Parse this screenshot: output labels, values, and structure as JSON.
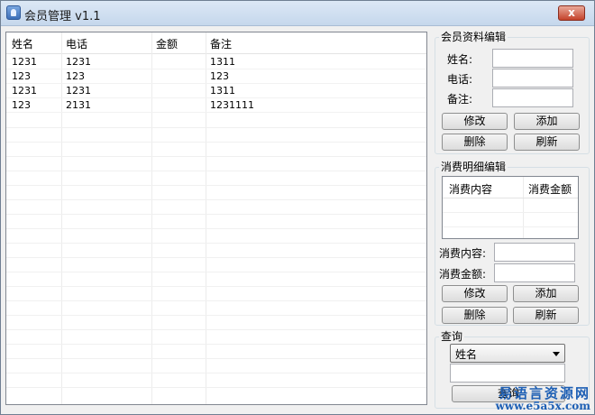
{
  "window": {
    "title": "会员管理 v1.1",
    "close_label": "x"
  },
  "member_list": {
    "columns": [
      "姓名",
      "电话",
      "金额",
      "备注"
    ],
    "rows": [
      [
        "1231",
        "1231",
        "",
        "1311"
      ],
      [
        "123",
        "123",
        "",
        "123"
      ],
      [
        "1231",
        "1231",
        "",
        "1311"
      ],
      [
        "123",
        "2131",
        "",
        "1231111"
      ]
    ]
  },
  "member_edit": {
    "title": "会员资料编辑",
    "name_label": "姓名:",
    "phone_label": "电话:",
    "note_label": "备注:",
    "name_value": "",
    "phone_value": "",
    "note_value": "",
    "modify_label": "修改",
    "add_label": "添加",
    "delete_label": "删除",
    "refresh_label": "刷新"
  },
  "consume_edit": {
    "title": "消费明细编辑",
    "columns": [
      "消费内容",
      "消费金额"
    ],
    "content_label": "消费内容:",
    "amount_label": "消费金额:",
    "content_value": "",
    "amount_value": "",
    "modify_label": "修改",
    "add_label": "添加",
    "delete_label": "删除",
    "refresh_label": "刷新"
  },
  "query": {
    "title": "查询",
    "field_selected": "姓名",
    "keyword_value": "",
    "search_label": "查询"
  },
  "watermark": {
    "line1": "易语言资源网",
    "line2": "www.e5a5x.com"
  }
}
